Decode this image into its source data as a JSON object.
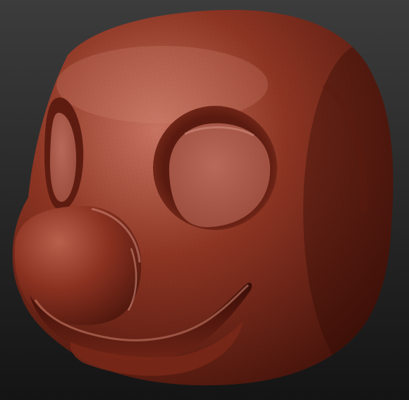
{
  "scene": {
    "subject": "sculpted-mascot-head",
    "colors": {
      "background_top": "#3c3c3c",
      "background_bottom": "#141414",
      "clay_highlight": "#c87462",
      "clay_base": "#8e3523",
      "clay_shadow": "#4a150c",
      "eye_socket": "#b8695a",
      "mouth_shadow": "#3a0d07"
    }
  }
}
